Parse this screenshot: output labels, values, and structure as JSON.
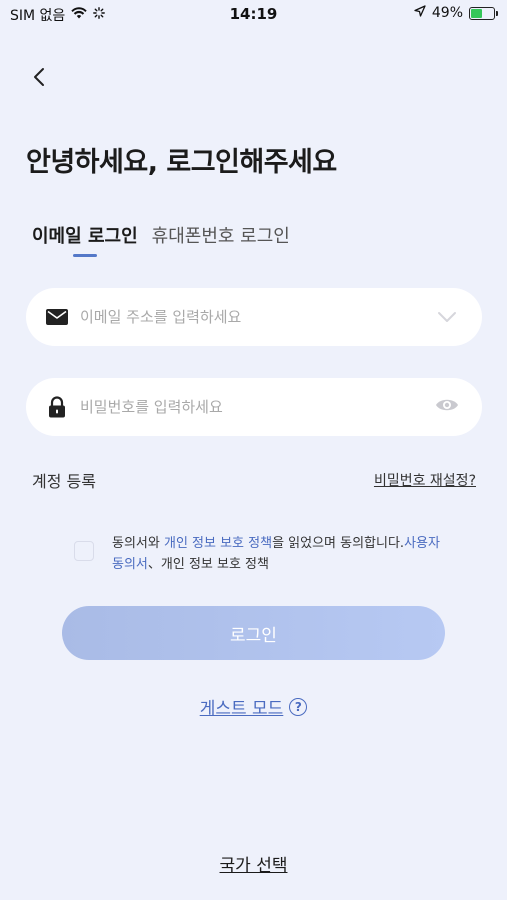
{
  "status_bar": {
    "carrier": "SIM 없음",
    "time": "14:19",
    "battery": "49%",
    "battery_level": 0.49
  },
  "header": {
    "back_icon": "chevron-left-icon",
    "title": "안녕하세요, 로그인해주세요"
  },
  "tabs": [
    {
      "label": "이메일 로그인",
      "active": true
    },
    {
      "label": "휴대폰번호 로그인",
      "active": false
    }
  ],
  "email_field": {
    "placeholder": "이메일 주소를 입력하세요",
    "value": "",
    "icon": "mail-icon",
    "trailing_icon": "chevron-down-icon"
  },
  "password_field": {
    "placeholder": "비밀번호를 입력하세요",
    "value": "",
    "icon": "lock-icon",
    "trailing_icon": "eye-icon"
  },
  "links": {
    "register": "계정 등록",
    "reset_password": "비밀번호 재설정?"
  },
  "agreement": {
    "checked": false,
    "part1": "동의서와 ",
    "link1": "개인 정보 보호 정책",
    "part2": "을 읽었으며 동의합니다.",
    "link2": "사용자 동의서",
    "part3": "、개인 정보 보호 정책"
  },
  "login_button": "로그인",
  "guest_mode": "게스트 모드",
  "country_select": "국가 선택",
  "colors": {
    "background": "#eef1fb",
    "accent": "#4a6bc0",
    "button_start": "#a9bbe6",
    "button_end": "#b7c9f3"
  }
}
